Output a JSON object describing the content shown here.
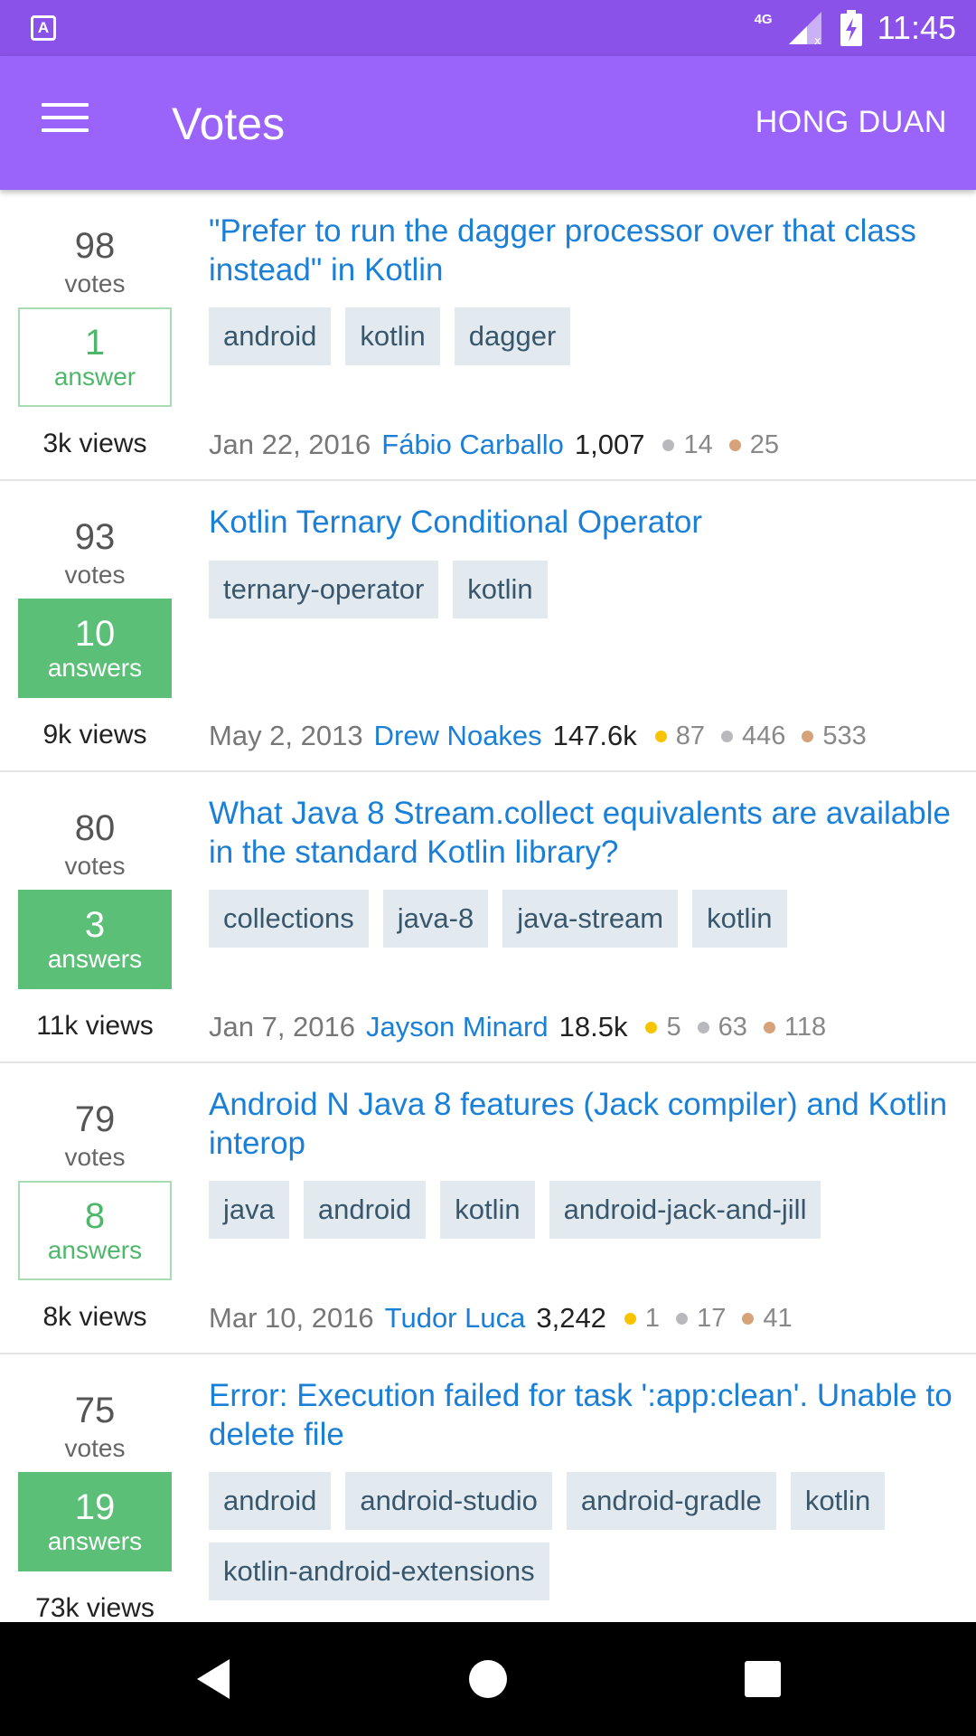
{
  "status_bar": {
    "network": "4G",
    "time": "11:45",
    "app_icon_letter": "A"
  },
  "app_bar": {
    "title": "Votes",
    "user": "HONG DUAN"
  },
  "colors": {
    "status_bar": "#8a52e8",
    "app_bar": "#9a63fa",
    "link": "#1a7fd6",
    "answered_fill": "#5cbf77",
    "answered_outline": "#4db86a",
    "tag_bg": "#e2eaf0",
    "gold": "#f8c400",
    "silver": "#b7b9bc",
    "bronze": "#d6a27a"
  },
  "questions": [
    {
      "votes": "98",
      "votes_label": "votes",
      "answers": "1",
      "answers_label": "answer",
      "accepted": false,
      "views": "3k views",
      "title": "\"Prefer to run the dagger processor over that class instead\" in Kotlin",
      "tags": [
        "android",
        "kotlin",
        "dagger"
      ],
      "date": "Jan 22, 2016",
      "user": "Fábio Carballo",
      "reputation": "1,007",
      "badges": [
        {
          "type": "silver",
          "count": "14"
        },
        {
          "type": "bronze",
          "count": "25"
        }
      ]
    },
    {
      "votes": "93",
      "votes_label": "votes",
      "answers": "10",
      "answers_label": "answers",
      "accepted": true,
      "views": "9k views",
      "title": "Kotlin Ternary Conditional Operator",
      "tags": [
        "ternary-operator",
        "kotlin"
      ],
      "date": "May 2, 2013",
      "user": "Drew Noakes",
      "reputation": "147.6k",
      "badges": [
        {
          "type": "gold",
          "count": "87"
        },
        {
          "type": "silver",
          "count": "446"
        },
        {
          "type": "bronze",
          "count": "533"
        }
      ]
    },
    {
      "votes": "80",
      "votes_label": "votes",
      "answers": "3",
      "answers_label": "answers",
      "accepted": true,
      "views": "11k views",
      "title": "What Java 8 Stream.collect equivalents are available in the standard Kotlin library?",
      "tags": [
        "collections",
        "java-8",
        "java-stream",
        "kotlin"
      ],
      "date": "Jan 7, 2016",
      "user": "Jayson Minard",
      "reputation": "18.5k",
      "badges": [
        {
          "type": "gold",
          "count": "5"
        },
        {
          "type": "silver",
          "count": "63"
        },
        {
          "type": "bronze",
          "count": "118"
        }
      ]
    },
    {
      "votes": "79",
      "votes_label": "votes",
      "answers": "8",
      "answers_label": "answers",
      "accepted": false,
      "views": "8k views",
      "title": "Android N Java 8 features (Jack compiler) and Kotlin interop",
      "tags": [
        "java",
        "android",
        "kotlin",
        "android-jack-and-jill"
      ],
      "date": "Mar 10, 2016",
      "user": "Tudor Luca",
      "reputation": "3,242",
      "badges": [
        {
          "type": "gold",
          "count": "1"
        },
        {
          "type": "silver",
          "count": "17"
        },
        {
          "type": "bronze",
          "count": "41"
        }
      ]
    },
    {
      "votes": "75",
      "votes_label": "votes",
      "answers": "19",
      "answers_label": "answers",
      "accepted": true,
      "views": "73k views",
      "title": "Error: Execution failed for task ':app:clean'. Unable to delete file",
      "tags": [
        "android",
        "android-studio",
        "android-gradle",
        "kotlin",
        "kotlin-android-extensions"
      ],
      "date": "",
      "user": "",
      "reputation": "",
      "badges": []
    }
  ],
  "nav_bar": {
    "back_icon": "back-triangle-icon",
    "home_icon": "home-circle-icon",
    "recents_icon": "recents-square-icon"
  }
}
